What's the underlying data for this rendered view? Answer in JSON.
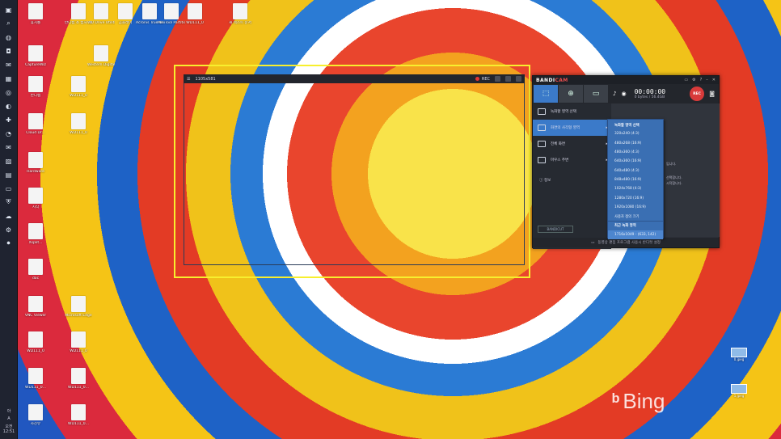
{
  "taskbar": {
    "icons": [
      "folder-icon",
      "search-icon",
      "chrome-icon",
      "camera-icon",
      "chat-icon",
      "calendar-icon",
      "gamepad-icon",
      "globe-icon",
      "red-app-icon",
      "clock-icon",
      "mail-icon",
      "photo-icon",
      "disk-icon",
      "monitor-icon",
      "shield-icon",
      "cloud-icon",
      "settings-icon",
      "bandicam-icon"
    ],
    "lang": "A",
    "lang_alt": "아",
    "time": "오전 12:51"
  },
  "desktop_icons": [
    {
      "label": "휴지통",
      "col": 0,
      "row": 0
    },
    {
      "label": "CaptureWiz",
      "col": 0,
      "row": 1
    },
    {
      "label": "반디캠",
      "col": 0,
      "row": 2
    },
    {
      "label": "Cloud Dr...",
      "col": 0,
      "row": 3
    },
    {
      "label": "Hardware",
      "col": 0,
      "row": 4
    },
    {
      "label": "시작",
      "col": 0,
      "row": 5
    },
    {
      "label": "Xsplit...",
      "col": 0,
      "row": 6
    },
    {
      "label": "doc",
      "col": 0,
      "row": 7
    },
    {
      "label": "VNC Viewer",
      "col": 0,
      "row": 8
    },
    {
      "label": "WD111_0",
      "col": 0,
      "row": 9
    },
    {
      "label": "WD111_0...",
      "col": 0,
      "row": 10
    },
    {
      "label": "사진뷰",
      "col": 0,
      "row": 11
    },
    {
      "label": "반디캠 쇼 캡처 가이",
      "col": 1,
      "row": 0
    },
    {
      "label": "WD Drive Utilities",
      "col": 2,
      "row": 0
    },
    {
      "label": "곰플레이",
      "col": 3,
      "row": 0
    },
    {
      "label": "Acronis True Image WD",
      "col": 4,
      "row": 0
    },
    {
      "label": "MiniTool Partition",
      "col": 5,
      "row": 0
    },
    {
      "label": "WD111_0",
      "col": 6,
      "row": 0
    },
    {
      "label": "새 텍스트 문서",
      "col": 7,
      "row": 0
    },
    {
      "label": "Western Digital S...",
      "col": 2,
      "row": 1
    },
    {
      "label": "WD111_0",
      "col": 1,
      "row": 2
    },
    {
      "label": "WD111_0",
      "col": 1,
      "row": 3
    },
    {
      "label": "Microsoft Edge",
      "col": 1,
      "row": 8
    },
    {
      "label": "WD111_0",
      "col": 1,
      "row": 9
    },
    {
      "label": "WD111_0...",
      "col": 1,
      "row": 10
    },
    {
      "label": "WD111_0...",
      "col": 1,
      "row": 11
    }
  ],
  "capture": {
    "size_label": "1105x581",
    "rec_label": "REC"
  },
  "bandicam": {
    "brand_a": "BANDI",
    "brand_b": "CAM",
    "timer": "00:00:00",
    "filesize": "0 bytes / 56.4GB",
    "rec_button": "REC",
    "left_items": [
      {
        "label": "녹화할 영역 선택",
        "active": false,
        "arrow": ""
      },
      {
        "label": "화면의 사각형 영역",
        "active": true,
        "arrow": "▸"
      },
      {
        "label": "전체 화면",
        "active": false,
        "arrow": "▸"
      },
      {
        "label": "마우스 주변",
        "active": false,
        "arrow": "▸"
      }
    ],
    "info_label": "정보",
    "bandicut_label": "BANDICUT",
    "right_lines": [
      "입니다.",
      "선택합니다.",
      "시작합니다."
    ],
    "right_steps": [
      "1. 녹화하고",
      "2. 녹화시작"
    ],
    "footer": "동영상 편집 프로그램 사용시 반디컷 설정"
  },
  "submenu": {
    "items": [
      {
        "label": "녹화할 영역 선택",
        "kind": "head"
      },
      {
        "label": "320x240 (4:3)",
        "kind": "item"
      },
      {
        "label": "480x268 (16:9)",
        "kind": "item"
      },
      {
        "label": "480x360 (4:3)",
        "kind": "item"
      },
      {
        "label": "640x360 (16:9)",
        "kind": "item"
      },
      {
        "label": "640x480 (4:3)",
        "kind": "item"
      },
      {
        "label": "848x480 (16:9)",
        "kind": "item"
      },
      {
        "label": "1024x768 (4:3)",
        "kind": "item"
      },
      {
        "label": "1280x720 (16:9)",
        "kind": "item"
      },
      {
        "label": "1920x1080 (16:9)",
        "kind": "item"
      },
      {
        "label": "사용자 정의 크기",
        "kind": "item"
      },
      {
        "label": "최근 녹화 영역",
        "kind": "head-sep"
      },
      {
        "label": "1716x1049 - (633, 142)",
        "kind": "hover"
      }
    ]
  },
  "right_desktop": [
    {
      "label": "0.jpeg"
    },
    {
      "label": "1.jpeg"
    }
  ],
  "bing_label": "Bing"
}
